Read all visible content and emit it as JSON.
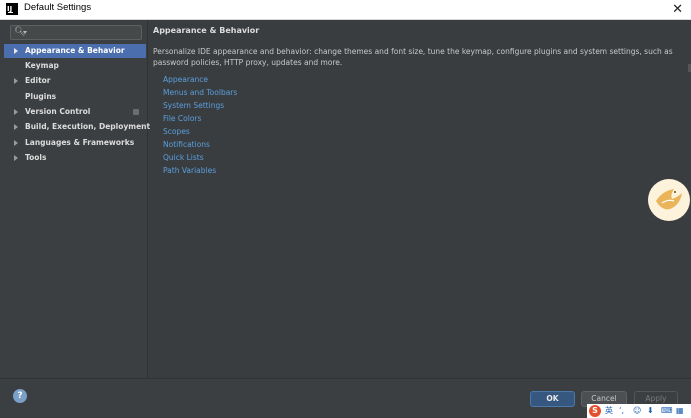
{
  "window": {
    "title": "Default Settings",
    "close_glyph": "✕"
  },
  "search": {
    "icon": "search-icon",
    "value": ""
  },
  "sidebar": {
    "items": [
      {
        "label": "Appearance & Behavior",
        "expandable": true,
        "selected": true
      },
      {
        "label": "Keymap",
        "expandable": false,
        "selected": false
      },
      {
        "label": "Editor",
        "expandable": true,
        "selected": false
      },
      {
        "label": "Plugins",
        "expandable": false,
        "selected": false
      },
      {
        "label": "Version Control",
        "expandable": true,
        "selected": false
      },
      {
        "label": "Build, Execution, Deployment",
        "expandable": true,
        "selected": false
      },
      {
        "label": "Languages & Frameworks",
        "expandable": true,
        "selected": false
      },
      {
        "label": "Tools",
        "expandable": true,
        "selected": false
      }
    ]
  },
  "main": {
    "title": "Appearance & Behavior",
    "description": "Personalize IDE appearance and behavior: change themes and font size, tune the keymap, configure plugins and system settings, such as password policies, HTTP proxy, updates and more.",
    "links": [
      "Appearance",
      "Menus and Toolbars",
      "System Settings",
      "File Colors",
      "Scopes",
      "Notifications",
      "Quick Lists",
      "Path Variables"
    ]
  },
  "footer": {
    "help_glyph": "?",
    "ok_label": "OK",
    "cancel_label": "Cancel",
    "apply_label": "Apply"
  },
  "ime": {
    "logo": "S",
    "lang": "英",
    "icons": [
      "punctuation-icon",
      "emoji-icon",
      "mic-icon",
      "keyboard-icon",
      "grid-icon"
    ]
  },
  "colors": {
    "accent": "#4b6eaf",
    "link": "#5a9fdc",
    "background": "#3c3f41"
  }
}
